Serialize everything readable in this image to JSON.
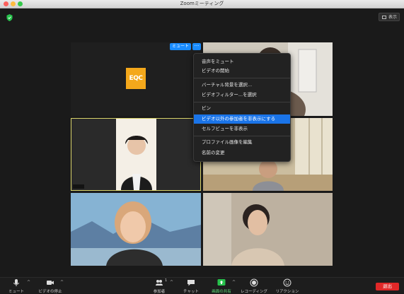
{
  "window": {
    "title": "Zoomミーティング"
  },
  "header": {
    "view_label": "表示"
  },
  "tile_overlay": {
    "mute_label": "ミュート",
    "more_label": "···",
    "logo_text": "EQC"
  },
  "context_menu": {
    "items": [
      {
        "label": "音声をミュート"
      },
      {
        "label": "ビデオの開始"
      },
      {
        "label": "バーチャル背景を選択..."
      },
      {
        "label": "ビデオフィルター...を選択"
      },
      {
        "label": "ピン"
      },
      {
        "label": "ビデオ以外の参加者を非表示にする",
        "selected": true
      },
      {
        "label": "セルフビューを非表示"
      },
      {
        "label": "プロファイル画像を編集"
      },
      {
        "label": "名前の変更"
      }
    ]
  },
  "toolbar": {
    "mute": "ミュート",
    "stop_video": "ビデオの停止",
    "participants": "参加者",
    "participants_count": "1",
    "chat": "チャット",
    "share": "画面の共有",
    "record": "レコーディング",
    "reactions": "リアクション",
    "end": "退出"
  },
  "colors": {
    "accent": "#1a8cff",
    "menu_selected": "#1a74e8",
    "share_green": "#27c24c",
    "end_red": "#e02828",
    "logo": "#f4a81b"
  }
}
